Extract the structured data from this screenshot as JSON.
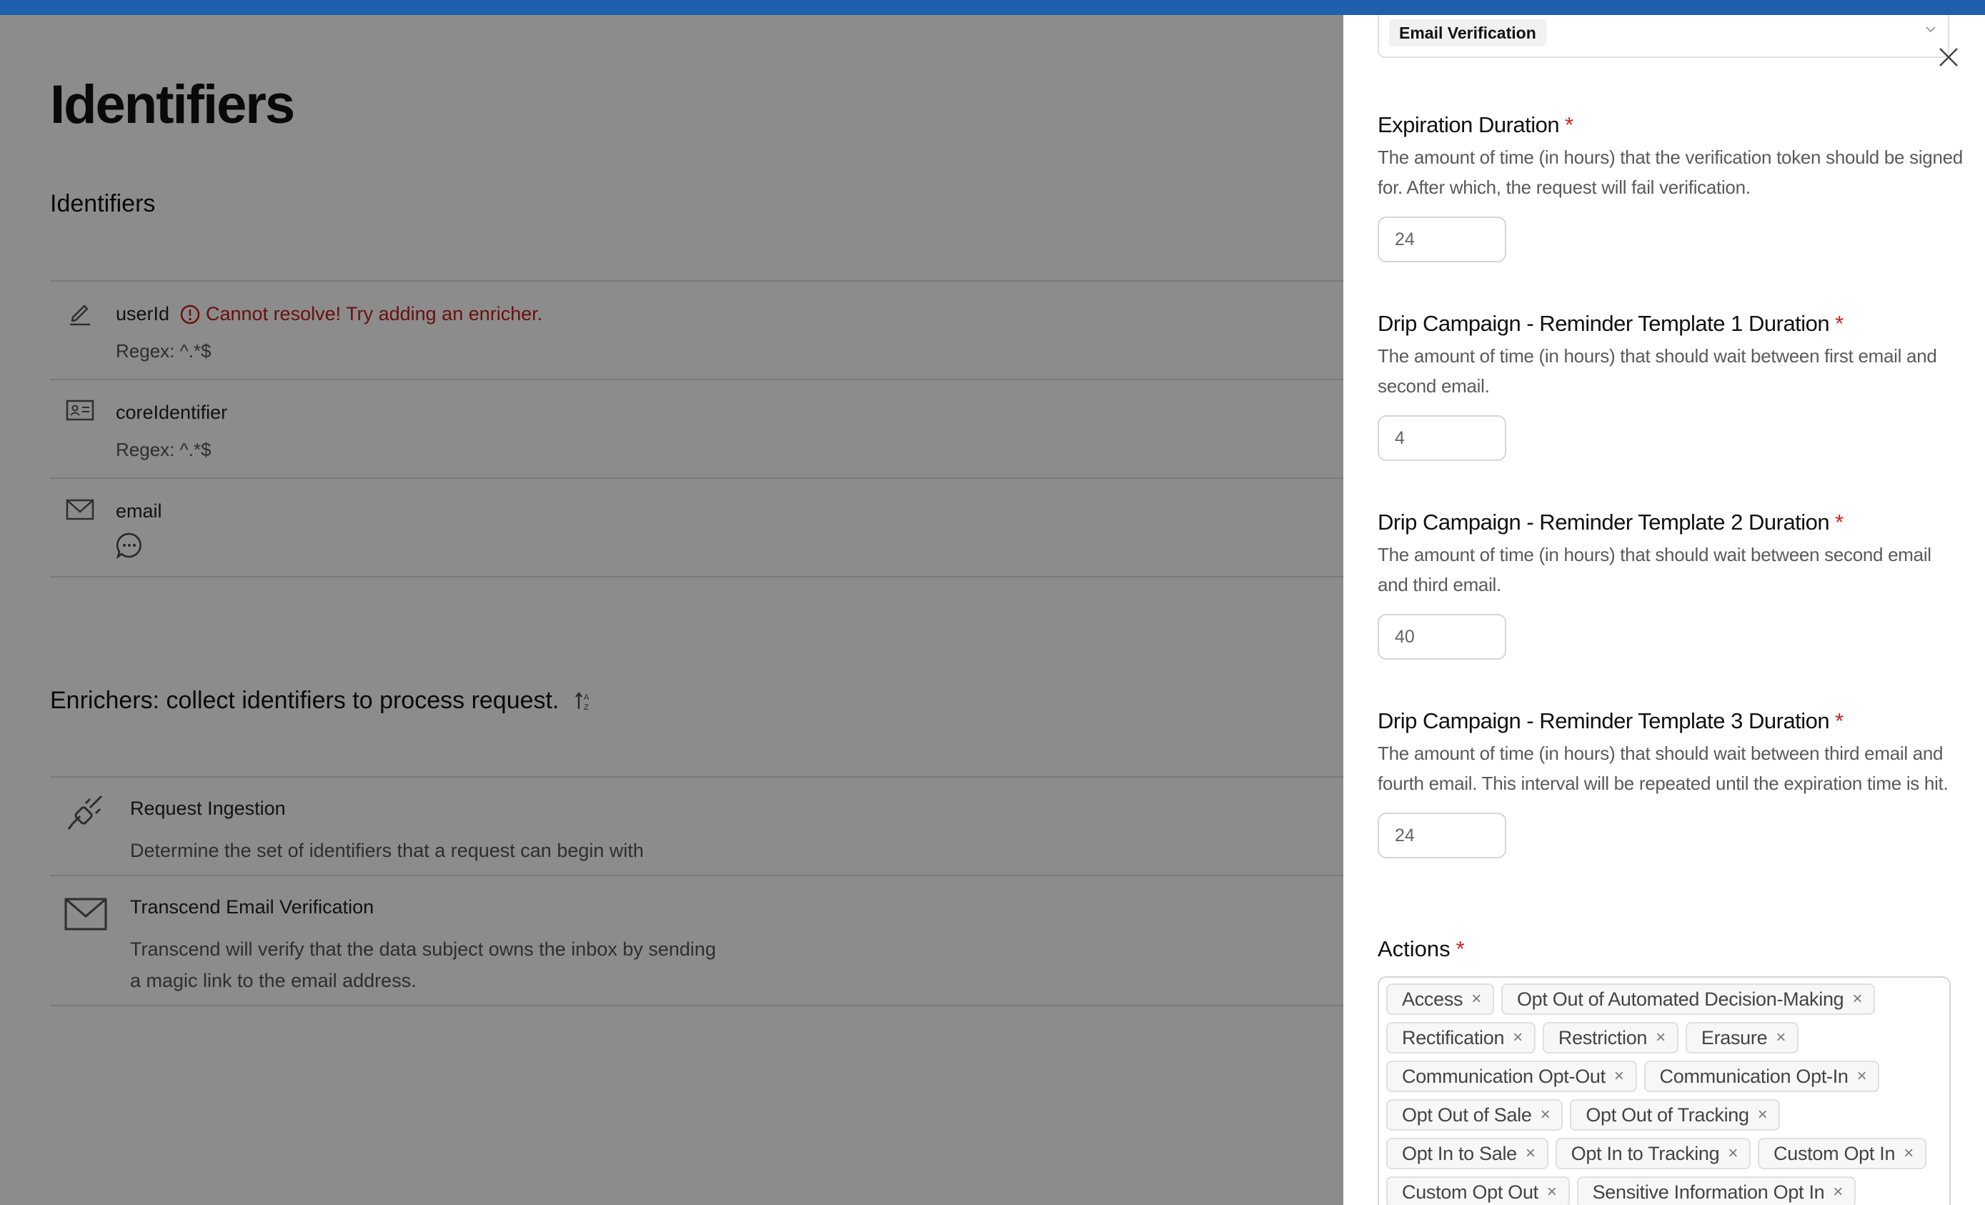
{
  "page": {
    "title": "Identifiers",
    "identifiers_section_title": "Identifiers",
    "identifiers": [
      {
        "name": "userId",
        "icon": "pencil-icon",
        "warning": "Cannot resolve! Try adding an enricher.",
        "regex": "Regex: ^.*$"
      },
      {
        "name": "coreIdentifier",
        "icon": "id-card-icon",
        "regex": "Regex: ^.*$"
      },
      {
        "name": "email",
        "icon": "envelope-icon"
      }
    ],
    "enrichers_section_title": "Enrichers: collect identifiers to process request.",
    "enrichers": [
      {
        "name": "Request Ingestion",
        "icon": "plug-icon",
        "description": "Determine the set of identifiers that a request can begin with"
      },
      {
        "name": "Transcend Email Verification",
        "icon": "envelope-icon",
        "description": "Transcend will verify that the data subject owns the inbox by sending a magic link to the email address."
      }
    ]
  },
  "drawer": {
    "selected_type": "Email Verification",
    "fields": [
      {
        "label": "Expiration Duration",
        "required_mark": "*",
        "help": "The amount of time (in hours) that the verification token should be signed for. After which, the request will fail verification.",
        "value": "24"
      },
      {
        "label": "Drip Campaign - Reminder Template 1 Duration",
        "required_mark": "*",
        "help": "The amount of time (in hours) that should wait between first email and second email.",
        "value": "4"
      },
      {
        "label": "Drip Campaign - Reminder Template 2 Duration",
        "required_mark": "*",
        "help": "The amount of time (in hours) that should wait between second email and third email.",
        "value": "40"
      },
      {
        "label": "Drip Campaign - Reminder Template 3 Duration",
        "required_mark": "*",
        "help": "The amount of time (in hours) that should wait between third email and fourth email. This interval will be repeated until the expiration time is hit.",
        "value": "24"
      }
    ],
    "actions_label": "Actions",
    "actions_required_mark": "*",
    "actions": [
      [
        "Access",
        "Opt Out of Automated Decision-Making"
      ],
      [
        "Rectification",
        "Restriction",
        "Erasure"
      ],
      [
        "Communication Opt-Out",
        "Communication Opt-In"
      ],
      [
        "Opt Out of Sale",
        "Opt Out of Tracking"
      ],
      [
        "Opt In to Sale",
        "Opt In to Tracking",
        "Custom Opt In"
      ],
      [
        "Custom Opt Out",
        "Sensitive Information Opt In"
      ]
    ],
    "tag_remove_glyph": "×"
  },
  "colors": {
    "topbar": "#1f5fad",
    "error": "#c0201b",
    "required": "#d0211c"
  }
}
